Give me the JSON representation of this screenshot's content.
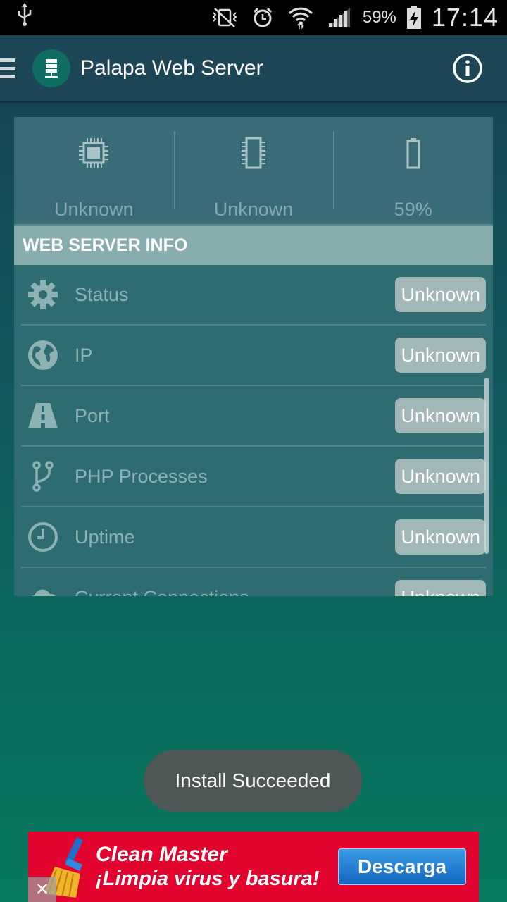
{
  "status_bar": {
    "battery_percent": "59%",
    "time": "17:14"
  },
  "app_bar": {
    "title": "Palapa Web Server"
  },
  "stats": [
    {
      "icon": "cpu-icon",
      "value": "Unknown"
    },
    {
      "icon": "ram-icon",
      "value": "Unknown"
    },
    {
      "icon": "battery-icon",
      "value": "59%"
    }
  ],
  "section": {
    "title": "WEB SERVER INFO",
    "rows": [
      {
        "icon": "gear-icon",
        "label": "Status",
        "value": "Unknown"
      },
      {
        "icon": "globe-icon",
        "label": "IP",
        "value": "Unknown"
      },
      {
        "icon": "road-icon",
        "label": "Port",
        "value": "Unknown"
      },
      {
        "icon": "fork-icon",
        "label": "PHP Processes",
        "value": "Unknown"
      },
      {
        "icon": "clock-icon",
        "label": "Uptime",
        "value": "Unknown"
      },
      {
        "icon": "cloud-icon",
        "label": "Current Connections",
        "value": "Unknown"
      }
    ]
  },
  "toast": {
    "message": "Install Succeeded"
  },
  "ad": {
    "title": "Clean Master",
    "subtitle": "¡Limpia virus y basura!",
    "button": "Descarga",
    "close": "✕"
  },
  "colors": {
    "accent": "#0f6d64",
    "ad_red": "#e2032f",
    "ad_button": "#1e7fd6"
  }
}
